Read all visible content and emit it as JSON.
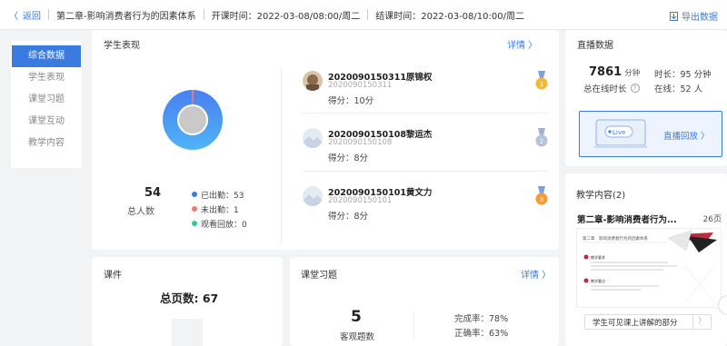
{
  "topbar": {
    "back": "返回",
    "chapter": "第二章-影响消费者行为的因素体系",
    "start": "开课时间：2022-03-08/08:00/周二",
    "end": "结课时间：2022-03-08/10:00/周二",
    "export": "导出数据"
  },
  "nav": [
    "综合数据",
    "学生表现",
    "课堂习题",
    "课堂互动",
    "教学内容"
  ],
  "performance": {
    "title": "学生表现",
    "more": "详情 〉",
    "total": "54",
    "total_label": "总人数",
    "legend": [
      {
        "label": "已出勤：53",
        "color": "#3a7be0"
      },
      {
        "label": "未出勤：1",
        "color": "#f07a7a"
      },
      {
        "label": "观看回放：0",
        "color": "#2ec8a0"
      }
    ],
    "students": [
      {
        "name": "2020090150311原锦权",
        "id": "2020090150311",
        "score": "得分：10分",
        "medal": "1",
        "medal_color": "#f5b731"
      },
      {
        "name": "2020090150108黎运杰",
        "id": "2020090150108",
        "score": "得分：8分",
        "medal": "2",
        "medal_color": "#b8c2d6"
      },
      {
        "name": "2020090150101黄文力",
        "id": "2020090150101",
        "score": "得分：8分",
        "medal": "3",
        "medal_color": "#f39a3c"
      }
    ]
  },
  "live": {
    "title": "直播数据",
    "total": "7861",
    "total_unit": "分钟",
    "total_label": "总在线时长",
    "duration": "时长：95 分钟",
    "online": "在线：52 人",
    "tag": "Live",
    "replay": "直播回放 〉"
  },
  "content": {
    "title": "教学内容(2)",
    "name": "第二章-影响消费者行为...",
    "pages": "26页",
    "tip": "学生可见课上讲解的部分",
    "tip_arrow": "〉",
    "slide_heading": "第二章　影响消费者行为的因素体系",
    "slide_bullets": [
      "教学要求",
      "教学重点"
    ]
  },
  "courseware": {
    "title": "课件",
    "total": "总页数: 67"
  },
  "exercise": {
    "title": "课堂习题",
    "more": "详情 〉",
    "count": "5",
    "count_label": "客观题数",
    "completion": "完成率：78%",
    "accuracy": "正确率：63%"
  }
}
